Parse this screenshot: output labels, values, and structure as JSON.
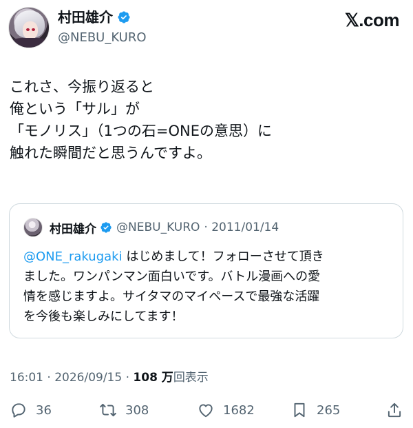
{
  "header": {
    "display_name": "村田雄介",
    "handle": "@NEBU_KURO",
    "brand": "𝕏.com"
  },
  "tweet": {
    "lines": [
      "これさ、今振り返ると",
      "俺という「サル」が",
      "「モノリス」（1つの石=ONEの意思）に",
      "触れた瞬間だと思うんですよ。"
    ]
  },
  "quote": {
    "display_name": "村田雄介",
    "handle": "@NEBU_KURO",
    "date": "· 2011/01/14",
    "mention": "@ONE_rakugaki",
    "line1_rest": " はじめまして！フォローさせて頂き",
    "lines": [
      "ました。ワンパンマン面白いです。バトル漫画への愛",
      "情を感じますよ。サイタマのマイペースで最強な活躍",
      "を今後も楽しみにしてます！"
    ]
  },
  "meta": {
    "time": "16:01 · 2026/09/15 · ",
    "views": "108 万",
    "views_label": "回表示"
  },
  "actions": {
    "replies": "36",
    "retweets": "308",
    "likes": "1682",
    "bookmarks": "265"
  },
  "colors": {
    "verified": "#1d9bf0",
    "mention": "#1d9bf0",
    "secondary_text": "#536471"
  }
}
